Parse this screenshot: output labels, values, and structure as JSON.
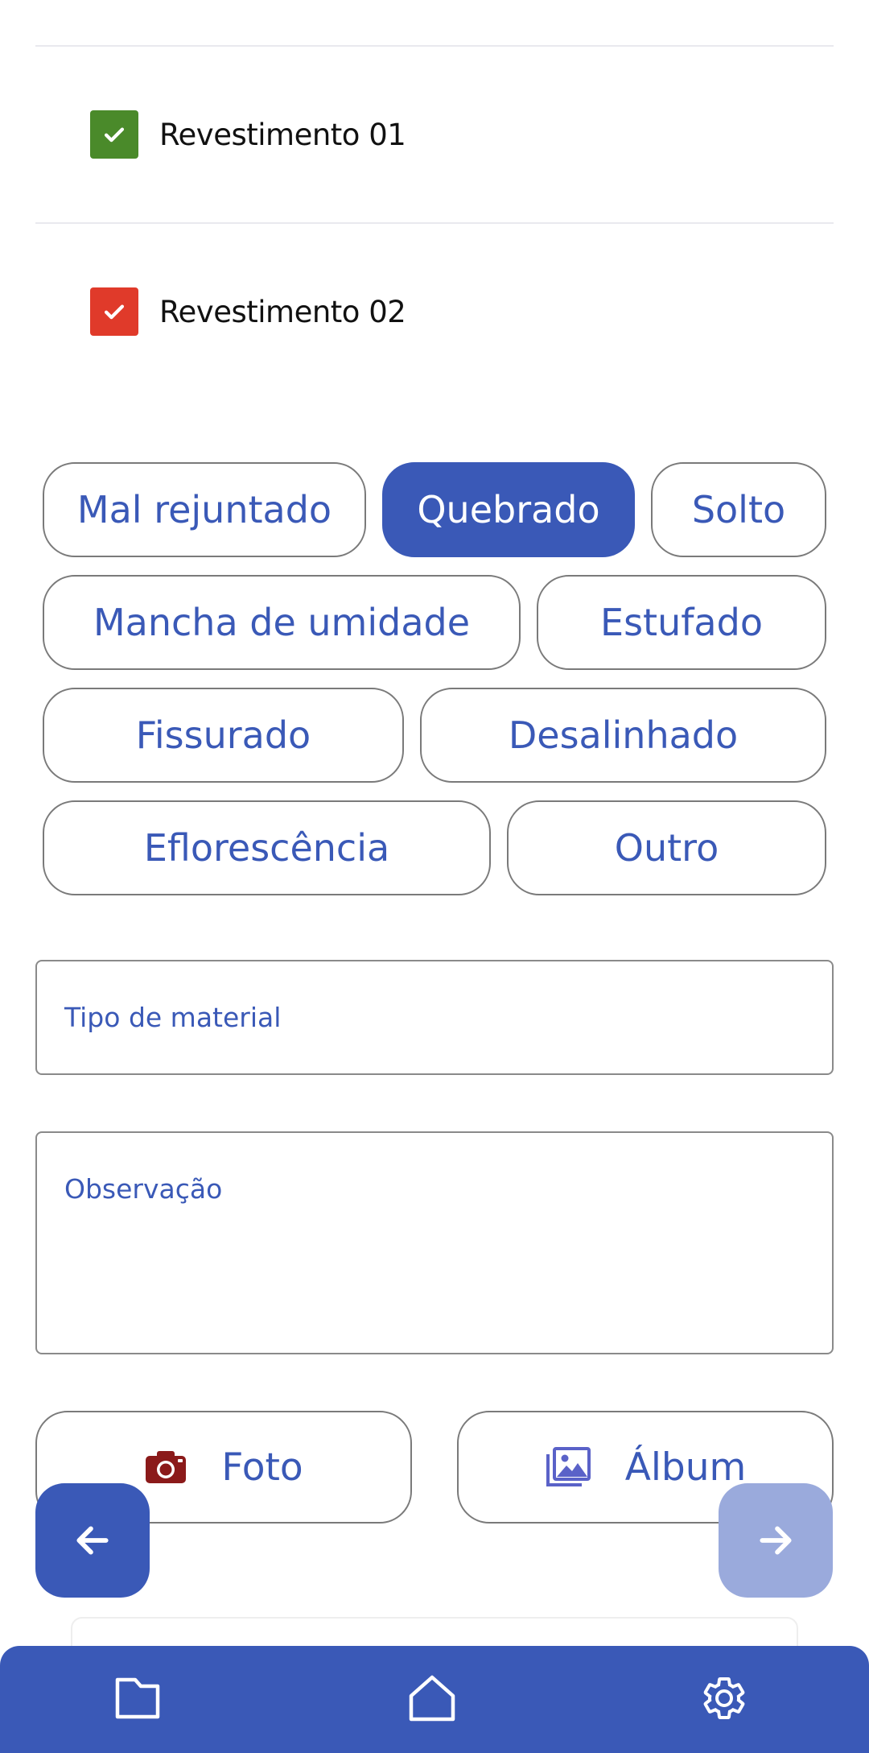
{
  "checklist": [
    {
      "label": "Revestimento 01",
      "color": "#4a8a2a",
      "checked": true
    },
    {
      "label": "Revestimento 02",
      "color": "#e03a2a",
      "checked": true
    }
  ],
  "chips": {
    "mal_rejuntado": "Mal rejuntado",
    "quebrado": "Quebrado",
    "solto": "Solto",
    "mancha_de_umidade": "Mancha de umidade",
    "estufado": "Estufado",
    "fissurado": "Fissurado",
    "desalinhado": "Desalinhado",
    "eflorescencia": "Eflorescência",
    "outro": "Outro",
    "selected": "Quebrado"
  },
  "fields": {
    "tipo_de_material": "Tipo de material",
    "observacao": "Observação"
  },
  "media": {
    "photo_label": "Foto",
    "album_label": "Álbum",
    "photo_icon": "camera-icon",
    "album_icon": "image-gallery-icon"
  },
  "navigation": {
    "back_icon": "arrow-left-icon",
    "next_icon": "arrow-right-icon",
    "next_enabled": false
  },
  "bottom_bar": {
    "items": [
      "folder-icon",
      "home-icon",
      "gear-icon"
    ]
  },
  "colors": {
    "accent": "#3a59b7",
    "accent_disabled": "#9aaadc",
    "checkbox_ok": "#4a8a2a",
    "checkbox_fail": "#e03a2a",
    "camera": "#8b1a1a",
    "album": "#5a62c8"
  }
}
